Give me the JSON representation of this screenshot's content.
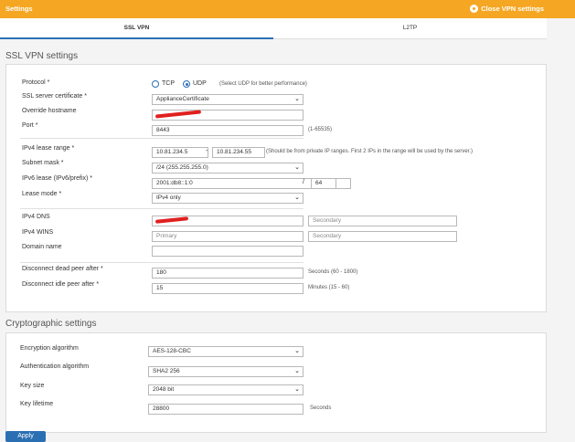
{
  "header": {
    "title": "Settings",
    "close_label": "Close VPN settings"
  },
  "tabs": [
    {
      "label": "SSL VPN"
    },
    {
      "label": "L2TP"
    }
  ],
  "ssl": {
    "section_title": "SSL VPN settings",
    "protocol": {
      "label": "Protocol *",
      "tcp": "TCP",
      "udp": "UDP",
      "hint": "(Select UDP for better performance)"
    },
    "certificate": {
      "label": "SSL server certificate *",
      "value": "ApplianceCertificate"
    },
    "hostname": {
      "label": "Override hostname"
    },
    "port": {
      "label": "Port *",
      "value": "8443",
      "hint": "(1-65535)"
    },
    "ipv4_range": {
      "label": "IPv4 lease range *",
      "start": "10.81.234.5",
      "dash": "-",
      "end": "10.81.234.55",
      "hint": "(Should be from private IP ranges. First 2 IPs in the range will be used by the server.)"
    },
    "subnet": {
      "label": "Subnet mask *",
      "value": "/24 (255.255.255.0)"
    },
    "ipv6": {
      "label": "IPv6 lease (IPv6/prefix) *",
      "value": "2001:db8::1:0",
      "slash": "/",
      "prefix": "64"
    },
    "lease_mode": {
      "label": "Lease mode *",
      "value": "IPv4 only"
    },
    "dns": {
      "label": "IPv4 DNS",
      "secondary": "Secondary"
    },
    "wins": {
      "label": "IPv4 WINS",
      "primary": "Primary",
      "secondary": "Secondary"
    },
    "domain": {
      "label": "Domain name"
    },
    "dead_peer": {
      "label": "Disconnect dead peer after *",
      "value": "180",
      "hint": "Seconds  (60 - 1800)"
    },
    "idle_peer": {
      "label": "Disconnect idle peer after *",
      "value": "15",
      "hint": "Minutes  (15 - 60)"
    }
  },
  "crypto": {
    "section_title": "Cryptographic settings",
    "encryption": {
      "label": "Encryption algorithm",
      "value": "AES-128-CBC"
    },
    "authentication": {
      "label": "Authentication algorithm",
      "value": "SHA2 256"
    },
    "key_size": {
      "label": "Key size",
      "value": "2048 bit"
    },
    "key_lifetime": {
      "label": "Key lifetime",
      "value": "28800",
      "hint": "Seconds"
    }
  },
  "footer": {
    "apply_label": "Apply"
  }
}
